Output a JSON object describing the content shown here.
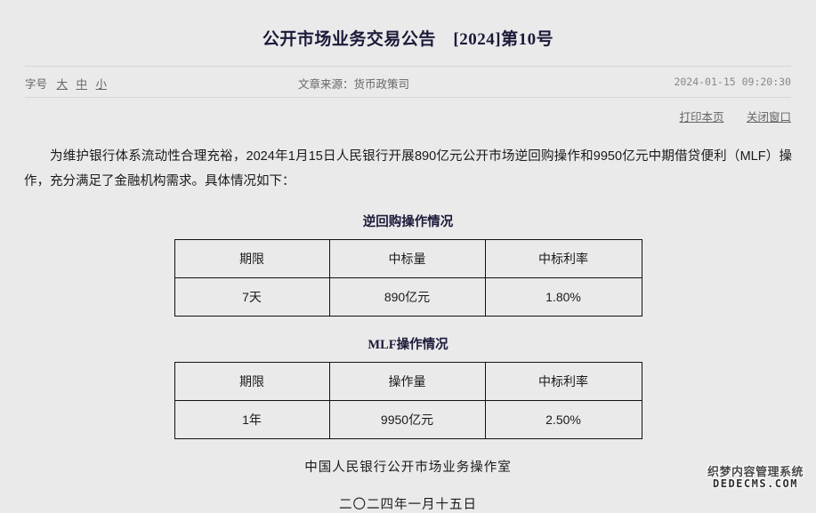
{
  "document": {
    "title": "公开市场业务交易公告　[2024]第10号"
  },
  "infobar": {
    "fontsize_label": "字号",
    "fontsize_options": [
      {
        "label": "大",
        "name": "large"
      },
      {
        "label": "中",
        "name": "medium"
      },
      {
        "label": "小",
        "name": "small"
      }
    ],
    "source": "文章来源：货币政策司",
    "timestamp": "2024-01-15 09:20:30"
  },
  "actions": {
    "print": "打印本页",
    "close": "关闭窗口"
  },
  "body": {
    "paragraph": "为维护银行体系流动性合理充裕，2024年1月15日人民银行开展890亿元公开市场逆回购操作和9950亿元中期借贷便利（MLF）操作，充分满足了金融机构需求。具体情况如下："
  },
  "tables": [
    {
      "caption": "逆回购操作情况",
      "headers": [
        "期限",
        "中标量",
        "中标利率"
      ],
      "rows": [
        [
          "7天",
          "890亿元",
          "1.80%"
        ]
      ]
    },
    {
      "caption": "MLF操作情况",
      "headers": [
        "期限",
        "操作量",
        "中标利率"
      ],
      "rows": [
        [
          "1年",
          "9950亿元",
          "2.50%"
        ]
      ]
    }
  ],
  "signature": {
    "organization": "中国人民银行公开市场业务操作室",
    "date": "二〇二四年一月十五日"
  },
  "watermark": {
    "cn": "织梦内容管理系统",
    "en": "DEDECMS.COM"
  },
  "colors": {
    "background": "#eaeaea",
    "title": "#1a1a3a",
    "text": "#1a1a1a",
    "muted": "#666666",
    "border": "#111111",
    "divider": "#d5d5d5"
  }
}
